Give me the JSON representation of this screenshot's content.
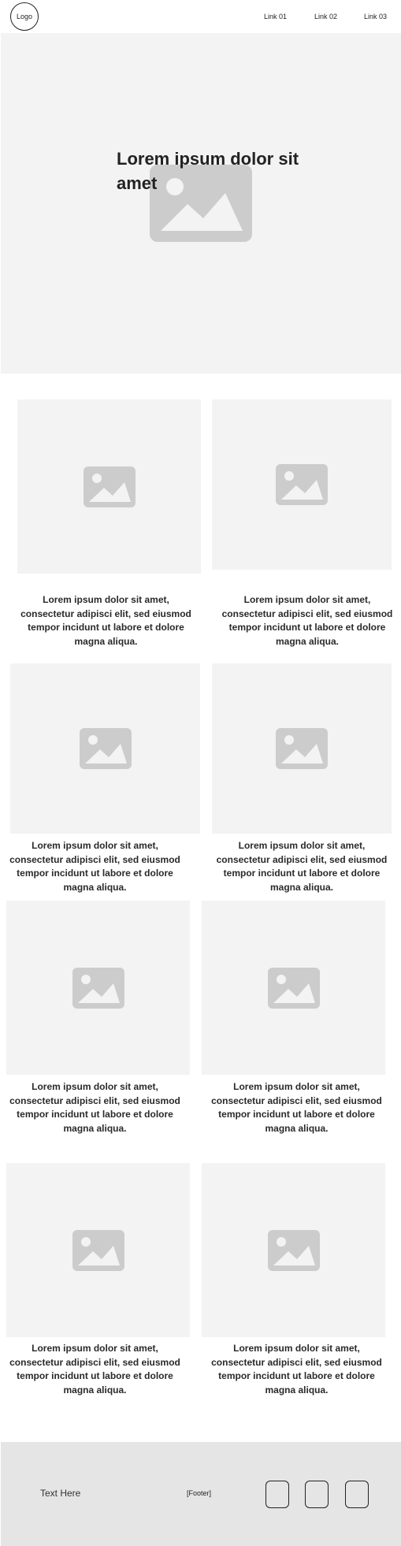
{
  "header": {
    "logo": "Logo",
    "links": [
      "Link 01",
      "Link 02",
      "Link 03"
    ]
  },
  "hero": {
    "title": "Lorem ipsum dolor sit amet",
    "image_icon": "image-placeholder-icon"
  },
  "cards": [
    {
      "text": "Lorem ipsum dolor sit amet, consectetur adipisci elit, sed eiusmod tempor incidunt ut labore et dolore magna aliqua."
    },
    {
      "text": "Lorem ipsum dolor sit amet, consectetur adipisci elit, sed eiusmod tempor incidunt ut labore et dolore magna aliqua."
    },
    {
      "text": "Lorem ipsum dolor sit amet, consectetur adipisci elit, sed eiusmod tempor incidunt ut labore et dolore magna aliqua."
    },
    {
      "text": "Lorem ipsum dolor sit amet, consectetur adipisci elit, sed eiusmod tempor incidunt ut labore et dolore magna aliqua."
    },
    {
      "text": "Lorem ipsum dolor sit amet, consectetur adipisci elit, sed eiusmod tempor incidunt ut labore et dolore magna aliqua."
    },
    {
      "text": "Lorem ipsum dolor sit amet, consectetur adipisci elit, sed eiusmod tempor incidunt ut labore et dolore magna aliqua."
    },
    {
      "text": "Lorem ipsum dolor sit amet, consectetur adipisci elit, sed eiusmod tempor incidunt ut labore et dolore magna aliqua."
    },
    {
      "text": "Lorem ipsum dolor sit amet, consectetur adipisci elit, sed eiusmod tempor incidunt ut labore et dolore magna aliqua."
    }
  ],
  "footer": {
    "text": "Text Here",
    "label": "[Footer]",
    "social_icons": [
      "social-icon",
      "social-icon",
      "social-icon"
    ]
  },
  "colors": {
    "placeholder_bg": "#f3f3f3",
    "placeholder_icon": "#cccccc",
    "footer_bg": "#e5e5e5",
    "text": "#222222"
  }
}
